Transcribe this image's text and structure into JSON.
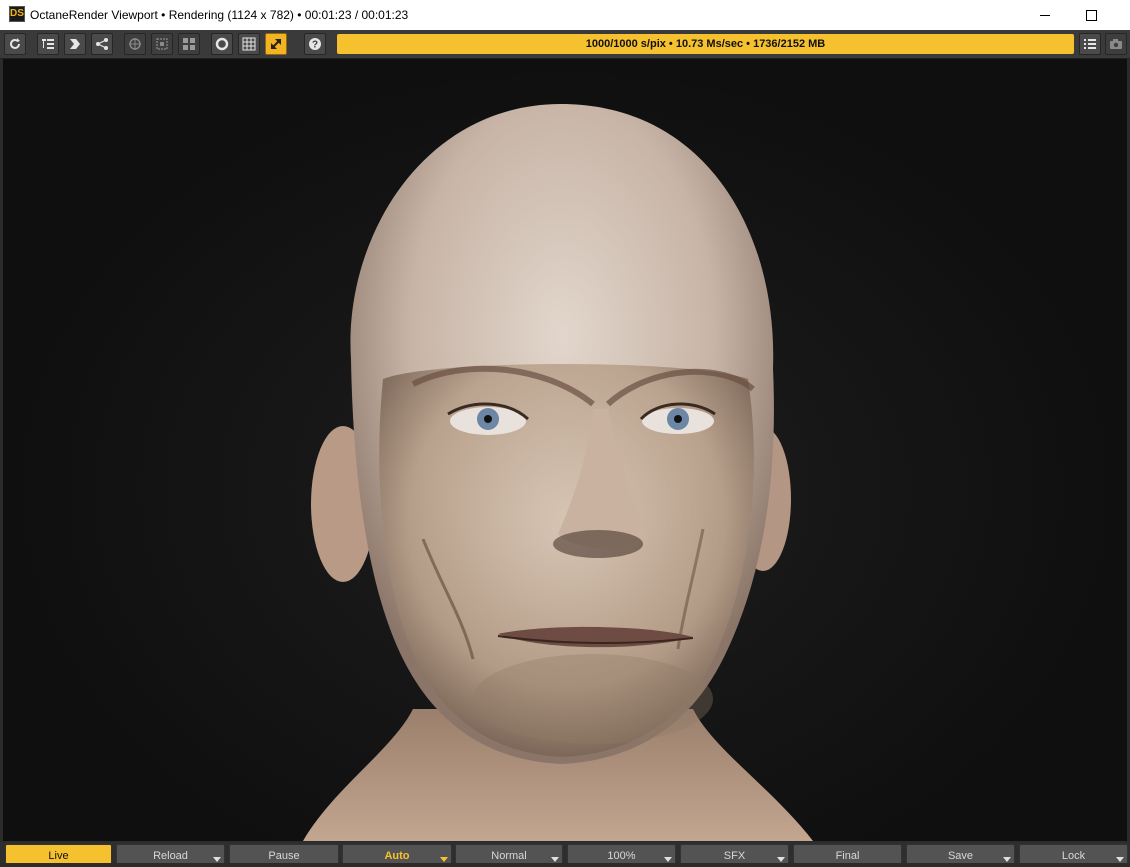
{
  "window": {
    "app_icon_text": "DS",
    "title": "OctaneRender Viewport • Rendering (1124 x 782) • 00:01:23 / 00:01:23"
  },
  "toolbar": {
    "status": "1000/1000 s/pix • 10.73 Ms/sec • 1736/2152 MB",
    "help_glyph": "?"
  },
  "viewport": {
    "image_description": "rendered 3D portrait of bald older man"
  },
  "bottom_buttons": [
    {
      "label": "Live",
      "state": "active"
    },
    {
      "label": "Reload",
      "state": "normal"
    },
    {
      "label": "Pause",
      "state": "normal"
    },
    {
      "label": "Auto",
      "state": "highlight"
    },
    {
      "label": "Normal",
      "state": "normal"
    },
    {
      "label": "100%",
      "state": "normal"
    },
    {
      "label": "SFX",
      "state": "normal"
    },
    {
      "label": "Final",
      "state": "normal"
    },
    {
      "label": "Save",
      "state": "normal"
    },
    {
      "label": "Lock",
      "state": "normal"
    }
  ],
  "colors": {
    "accent": "#f6c12f",
    "toolbar_bg": "#3a3a3a",
    "viewport_bg": "#111111"
  }
}
